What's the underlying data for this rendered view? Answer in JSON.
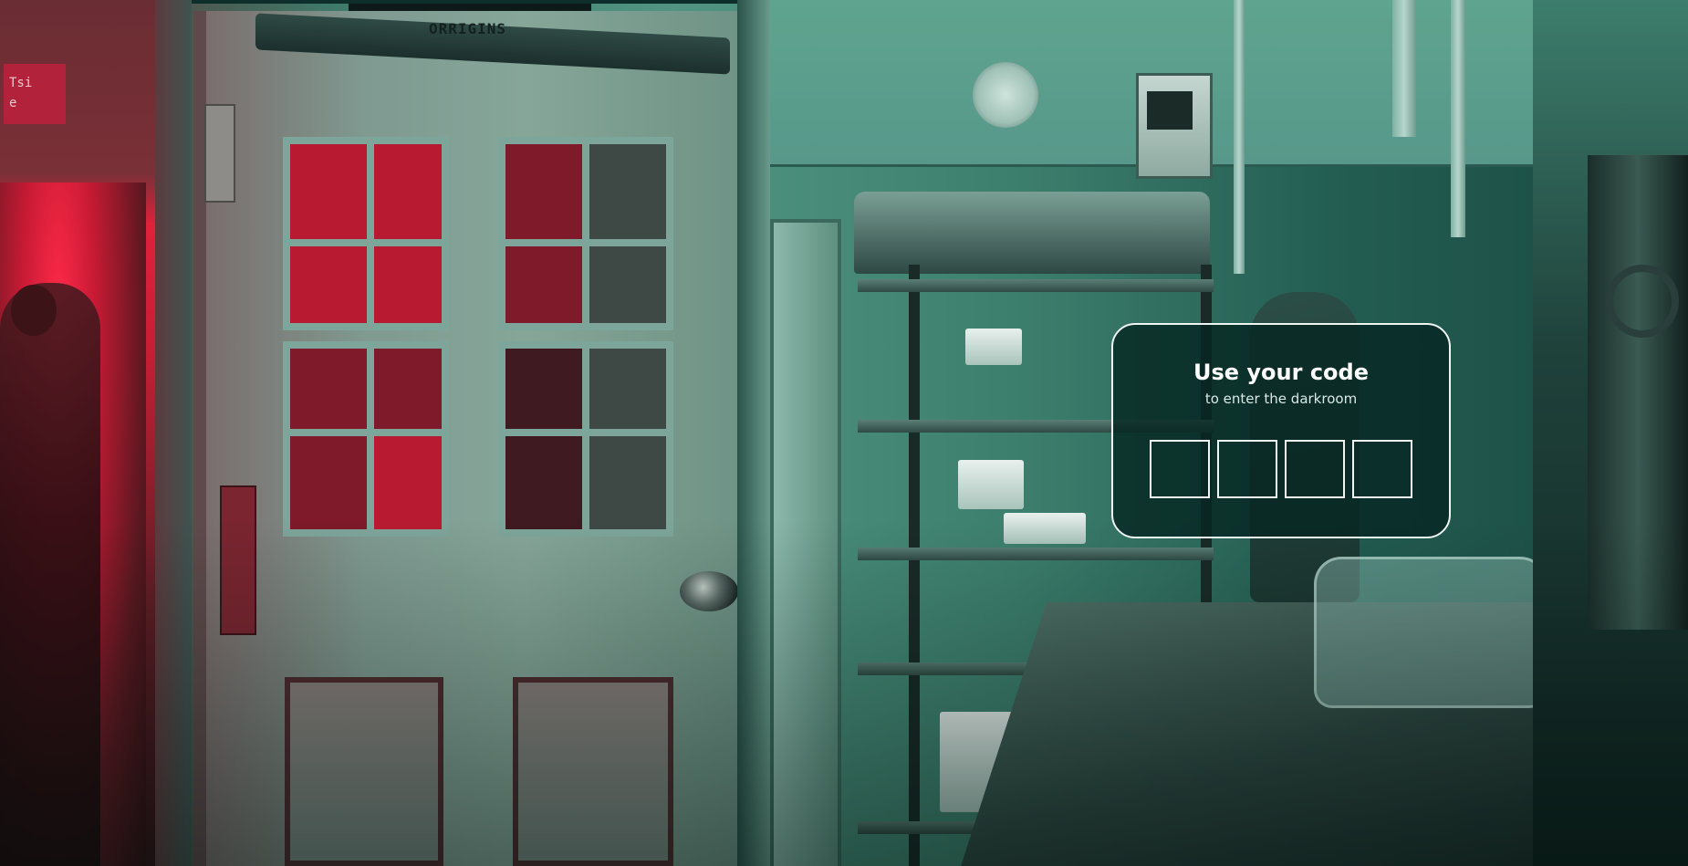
{
  "code_prompt": {
    "title": "Use your code",
    "subtitle": "to enter the darkroom",
    "digits": [
      {
        "value": ""
      },
      {
        "value": ""
      },
      {
        "value": ""
      },
      {
        "value": ""
      }
    ]
  },
  "scene": {
    "door_closer_label": "ORRIGINS",
    "wall_sign_lines": [
      "Tsi",
      "e"
    ]
  },
  "colors": {
    "card_border": "#eef5f3",
    "card_background": "#062622",
    "text": "#ffffff",
    "safelight_red": "#e0213c",
    "room_tint": "#4f9581"
  }
}
